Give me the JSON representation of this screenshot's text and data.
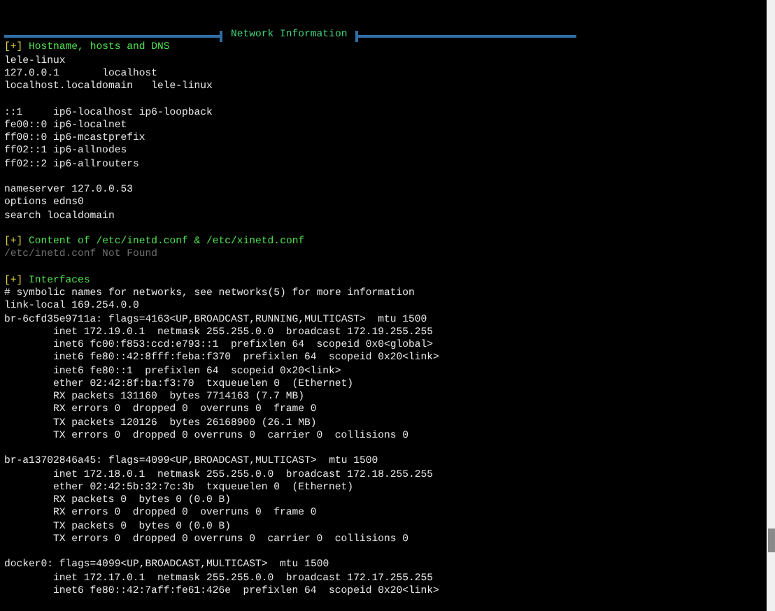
{
  "banner": {
    "title": "Network Information"
  },
  "lines": [
    {
      "kind": "heading",
      "marker": "[+]",
      "text": "Hostname, hosts and DNS"
    },
    {
      "kind": "text",
      "text": "lele-linux"
    },
    {
      "kind": "text",
      "text": "127.0.0.1       localhost"
    },
    {
      "kind": "text",
      "text": "localhost.localdomain   lele-linux"
    },
    {
      "kind": "blank"
    },
    {
      "kind": "text",
      "text": "::1     ip6-localhost ip6-loopback"
    },
    {
      "kind": "text",
      "text": "fe00::0 ip6-localnet"
    },
    {
      "kind": "text",
      "text": "ff00::0 ip6-mcastprefix"
    },
    {
      "kind": "text",
      "text": "ff02::1 ip6-allnodes"
    },
    {
      "kind": "text",
      "text": "ff02::2 ip6-allrouters"
    },
    {
      "kind": "blank"
    },
    {
      "kind": "text",
      "text": "nameserver 127.0.0.53"
    },
    {
      "kind": "text",
      "text": "options edns0"
    },
    {
      "kind": "text",
      "text": "search localdomain"
    },
    {
      "kind": "blank"
    },
    {
      "kind": "heading",
      "marker": "[+]",
      "text": "Content of /etc/inetd.conf & /etc/xinetd.conf"
    },
    {
      "kind": "dim",
      "text": "/etc/inetd.conf Not Found"
    },
    {
      "kind": "blank"
    },
    {
      "kind": "heading",
      "marker": "[+]",
      "text": "Interfaces"
    },
    {
      "kind": "text",
      "text": "# symbolic names for networks, see networks(5) for more information"
    },
    {
      "kind": "text",
      "text": "link-local 169.254.0.0"
    },
    {
      "kind": "text",
      "text": "br-6cfd35e9711a: flags=4163<UP,BROADCAST,RUNNING,MULTICAST>  mtu 1500"
    },
    {
      "kind": "detail",
      "text": "inet 172.19.0.1  netmask 255.255.0.0  broadcast 172.19.255.255"
    },
    {
      "kind": "detail",
      "text": "inet6 fc00:f853:ccd:e793::1  prefixlen 64  scopeid 0x0<global>"
    },
    {
      "kind": "detail",
      "text": "inet6 fe80::42:8fff:feba:f370  prefixlen 64  scopeid 0x20<link>"
    },
    {
      "kind": "detail",
      "text": "inet6 fe80::1  prefixlen 64  scopeid 0x20<link>"
    },
    {
      "kind": "detail",
      "text": "ether 02:42:8f:ba:f3:70  txqueuelen 0  (Ethernet)"
    },
    {
      "kind": "detail",
      "text": "RX packets 131160  bytes 7714163 (7.7 MB)"
    },
    {
      "kind": "detail",
      "text": "RX errors 0  dropped 0  overruns 0  frame 0"
    },
    {
      "kind": "detail",
      "text": "TX packets 120126  bytes 26168900 (26.1 MB)"
    },
    {
      "kind": "detail",
      "text": "TX errors 0  dropped 0 overruns 0  carrier 0  collisions 0"
    },
    {
      "kind": "blank"
    },
    {
      "kind": "text",
      "text": "br-a13702846a45: flags=4099<UP,BROADCAST,MULTICAST>  mtu 1500"
    },
    {
      "kind": "detail",
      "text": "inet 172.18.0.1  netmask 255.255.0.0  broadcast 172.18.255.255"
    },
    {
      "kind": "detail",
      "text": "ether 02:42:5b:32:7c:3b  txqueuelen 0  (Ethernet)"
    },
    {
      "kind": "detail",
      "text": "RX packets 0  bytes 0 (0.0 B)"
    },
    {
      "kind": "detail",
      "text": "RX errors 0  dropped 0  overruns 0  frame 0"
    },
    {
      "kind": "detail",
      "text": "TX packets 0  bytes 0 (0.0 B)"
    },
    {
      "kind": "detail",
      "text": "TX errors 0  dropped 0 overruns 0  carrier 0  collisions 0"
    },
    {
      "kind": "blank"
    },
    {
      "kind": "text",
      "text": "docker0: flags=4099<UP,BROADCAST,MULTICAST>  mtu 1500"
    },
    {
      "kind": "detail",
      "text": "inet 172.17.0.1  netmask 255.255.0.0  broadcast 172.17.255.255"
    },
    {
      "kind": "detail",
      "text": "inet6 fe80::42:7aff:fe61:426e  prefixlen 64  scopeid 0x20<link>"
    }
  ]
}
